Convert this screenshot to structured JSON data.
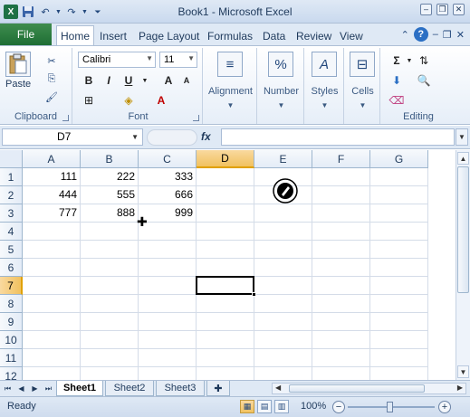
{
  "titlebar": {
    "title": "Book1 - Microsoft Excel",
    "app_icon": "X",
    "qat": [
      "save-icon",
      "undo-icon",
      "redo-icon",
      "customize-icon"
    ],
    "window_buttons": {
      "minimize": "–",
      "restore": "❐",
      "close": "✕"
    }
  },
  "tabs": {
    "file": "File",
    "items": [
      "Home",
      "Insert",
      "Page Layout",
      "Formulas",
      "Data",
      "Review",
      "View"
    ],
    "help": "?"
  },
  "ribbon": {
    "clipboard": {
      "label": "Clipboard",
      "paste": "Paste"
    },
    "font": {
      "label": "Font",
      "font_name": "Calibri",
      "font_size": "11",
      "bold": "B",
      "italic": "I",
      "underline": "U",
      "grow": "A",
      "shrink": "A"
    },
    "alignment": {
      "label": "Alignment"
    },
    "number": {
      "label": "Number",
      "percent": "%"
    },
    "styles": {
      "label": "Styles"
    },
    "cells": {
      "label": "Cells"
    },
    "editing": {
      "label": "Editing",
      "sum": "Σ"
    }
  },
  "formula_bar": {
    "name_box": "D7",
    "fx": "fx",
    "value": ""
  },
  "sheet": {
    "columns": [
      "A",
      "B",
      "C",
      "D",
      "E",
      "F",
      "G"
    ],
    "rows": [
      "1",
      "2",
      "3",
      "4",
      "5",
      "6",
      "7",
      "8",
      "9",
      "10",
      "11",
      "12"
    ],
    "cells": [
      [
        "111",
        "222",
        "333"
      ],
      [
        "444",
        "555",
        "666"
      ],
      [
        "777",
        "888",
        "999"
      ]
    ],
    "selected_column": "D",
    "selected_row": "7"
  },
  "sheet_tabs": [
    "Sheet1",
    "Sheet2",
    "Sheet3"
  ],
  "status": {
    "ready": "Ready",
    "zoom": "100%",
    "zoom_minus": "−",
    "zoom_plus": "+"
  },
  "colors": {
    "file_tab": "#1e6e34",
    "selected_header": "#f1c15f",
    "grid_line": "#d4dce8"
  }
}
